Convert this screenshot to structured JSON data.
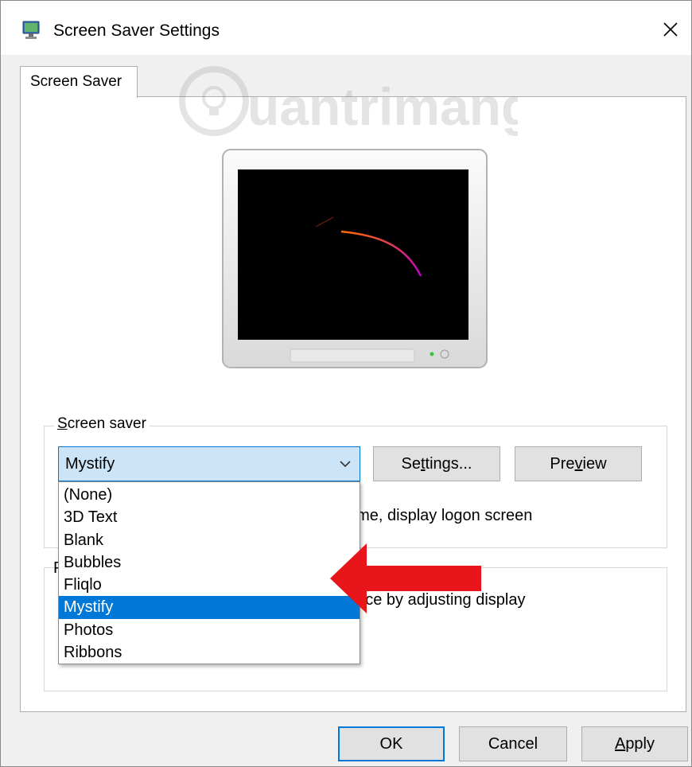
{
  "window": {
    "title": "Screen Saver Settings",
    "icon": "screen-saver-monitor-icon",
    "close_label": "✕"
  },
  "tabs": [
    {
      "label": "Screen Saver",
      "active": true
    }
  ],
  "watermark": {
    "text": "uantrimang"
  },
  "screen_saver_group": {
    "legend": "Screen saver",
    "selected_value": "Mystify",
    "settings_button": "Settings...",
    "preview_button": "Preview",
    "options": [
      "(None)",
      "3D Text",
      "Blank",
      "Bubbles",
      "Fliqlo",
      "Mystify",
      "Photos",
      "Ribbons"
    ],
    "highlighted_option": "Mystify",
    "logon_text_fragment": "ume, display logon screen"
  },
  "power_group": {
    "legend_fragment": "P",
    "text_fragment": "ance by adjusting display"
  },
  "footer": {
    "ok": "OK",
    "cancel": "Cancel",
    "apply": "Apply"
  },
  "colors": {
    "accent": "#0078d7",
    "annotation_arrow": "#e8161b"
  }
}
